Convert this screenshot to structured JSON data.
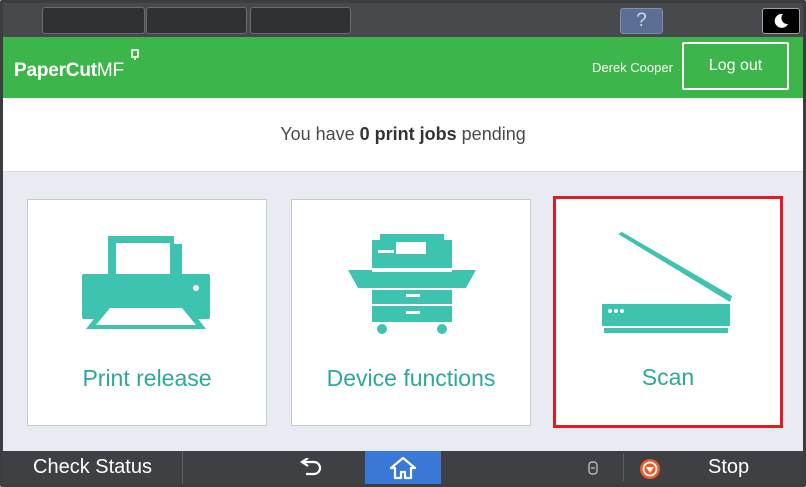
{
  "system_bar": {
    "help_label": "?"
  },
  "header": {
    "logo_main": "PaperCut",
    "logo_suffix": "MF",
    "user_name": "Derek Cooper",
    "logout_label": "Log out",
    "brand_color": "#3cb54a"
  },
  "pending": {
    "prefix": "You have ",
    "count_text": "0 print jobs",
    "suffix": " pending"
  },
  "tiles": [
    {
      "label": "Print release",
      "icon": "printer-icon"
    },
    {
      "label": "Device functions",
      "icon": "copier-icon"
    },
    {
      "label": "Scan",
      "icon": "scanner-icon"
    }
  ],
  "accent_color": "#3fc3b1",
  "selected_outline_color": "#e01b24",
  "bottom_bar": {
    "check_status_label": "Check Status",
    "stop_label": "Stop"
  }
}
